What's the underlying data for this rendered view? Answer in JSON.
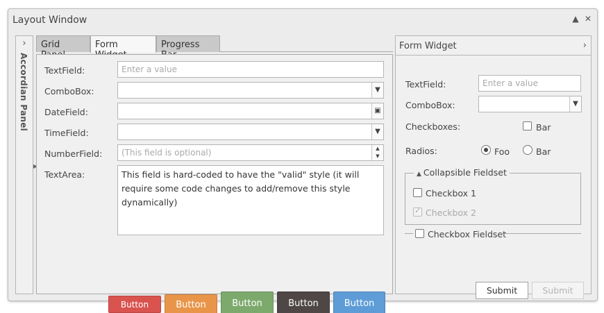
{
  "window": {
    "title": "Layout Window",
    "collapse_icon": "chevron-up-icon",
    "close_icon": "close-icon"
  },
  "accordion": {
    "title": "Accordian Panel",
    "expand_icon": "chevron-right-icon"
  },
  "tabs": [
    {
      "label": "Grid Panel"
    },
    {
      "label": "Form Widget"
    },
    {
      "label": "Progress Bar"
    }
  ],
  "form": {
    "textfield": {
      "label": "TextField:",
      "placeholder": "Enter a value"
    },
    "combobox": {
      "label": "ComboBox:",
      "value": ""
    },
    "datefield": {
      "label": "DateField:",
      "value": ""
    },
    "timefield": {
      "label": "TimeField:",
      "value": ""
    },
    "numberfield": {
      "label": "NumberField:",
      "placeholder": "(This field is optional)"
    },
    "textarea": {
      "label": "TextArea:",
      "value": "This field is hard-coded to have the \"valid\" style (it will require some code changes to add/remove this style dynamically)"
    }
  },
  "buttons": [
    {
      "label": "Button",
      "color": "#d9534f"
    },
    {
      "label": "Button",
      "color": "#e8954a"
    },
    {
      "label": "Button",
      "color": "#7caa6d"
    },
    {
      "label": "Button",
      "color": "#4e4745"
    },
    {
      "label": "Button",
      "color": "#5d9cd7"
    }
  ],
  "form_panel": {
    "title": "Form Widget",
    "textfield": {
      "label": "TextField:",
      "placeholder": "Enter a value"
    },
    "combobox": {
      "label": "ComboBox:"
    },
    "checkboxes": {
      "label": "Checkboxes:",
      "option": "Bar",
      "checked": false
    },
    "radios": {
      "label": "Radios:",
      "options": [
        "Foo",
        "Bar"
      ],
      "selected": "Foo"
    },
    "collapsible_fieldset": {
      "legend": "Collapsible Fieldset",
      "checkbox1": {
        "label": "Checkbox 1",
        "checked": false
      },
      "checkbox2": {
        "label": "Checkbox 2",
        "checked": true,
        "disabled": true
      }
    },
    "checkbox_fieldset": {
      "legend": "Checkbox Fieldset",
      "checked": false
    },
    "submit": "Submit",
    "submit_disabled": "Submit"
  }
}
